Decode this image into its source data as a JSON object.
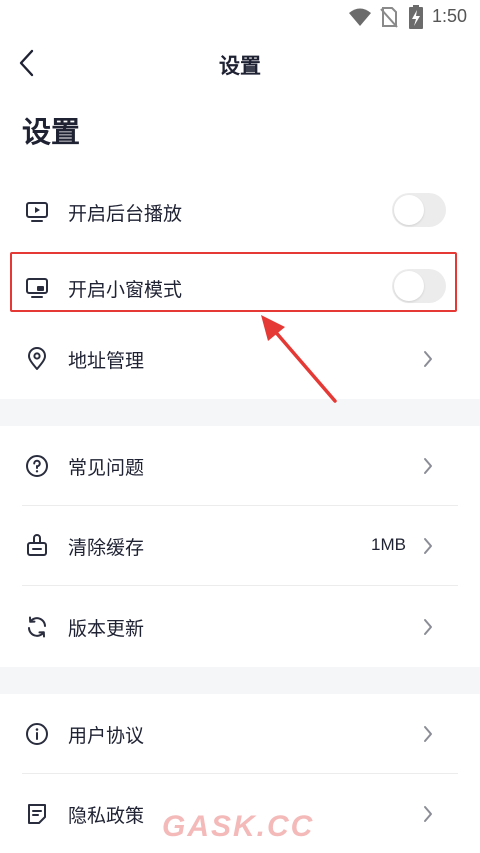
{
  "status_bar": {
    "time": "1:50",
    "icons": [
      "wifi-icon",
      "no-sim-icon",
      "battery-charging-icon"
    ]
  },
  "nav": {
    "title": "设置",
    "back_icon": "chevron-left-icon"
  },
  "page": {
    "heading": "设置"
  },
  "sections": [
    {
      "items": [
        {
          "label": "开启后台播放",
          "icon": "tv-play-icon",
          "control": "toggle",
          "on": false
        },
        {
          "label": "开启小窗模式",
          "icon": "picture-in-picture-icon",
          "control": "toggle",
          "on": false,
          "highlighted": true
        },
        {
          "label": "地址管理",
          "icon": "location-pin-icon",
          "control": "chevron"
        }
      ]
    },
    {
      "items": [
        {
          "label": "常见问题",
          "icon": "help-circle-icon",
          "control": "chevron"
        },
        {
          "label": "清除缓存",
          "icon": "clear-cache-icon",
          "control": "chevron",
          "value": "1MB"
        },
        {
          "label": "版本更新",
          "icon": "refresh-icon",
          "control": "chevron"
        }
      ]
    },
    {
      "items": [
        {
          "label": "用户协议",
          "icon": "info-circle-icon",
          "control": "chevron"
        },
        {
          "label": "隐私政策",
          "icon": "document-icon",
          "control": "chevron"
        }
      ]
    }
  ],
  "annotation": {
    "color": "#e53935",
    "icon": "red-arrow-icon"
  },
  "watermark": {
    "text": "GASK.CC"
  },
  "colors": {
    "text": "#1f2233",
    "section_gap": "#f5f6f8",
    "toggle_off": "#ececec",
    "highlight": "#e53935"
  }
}
